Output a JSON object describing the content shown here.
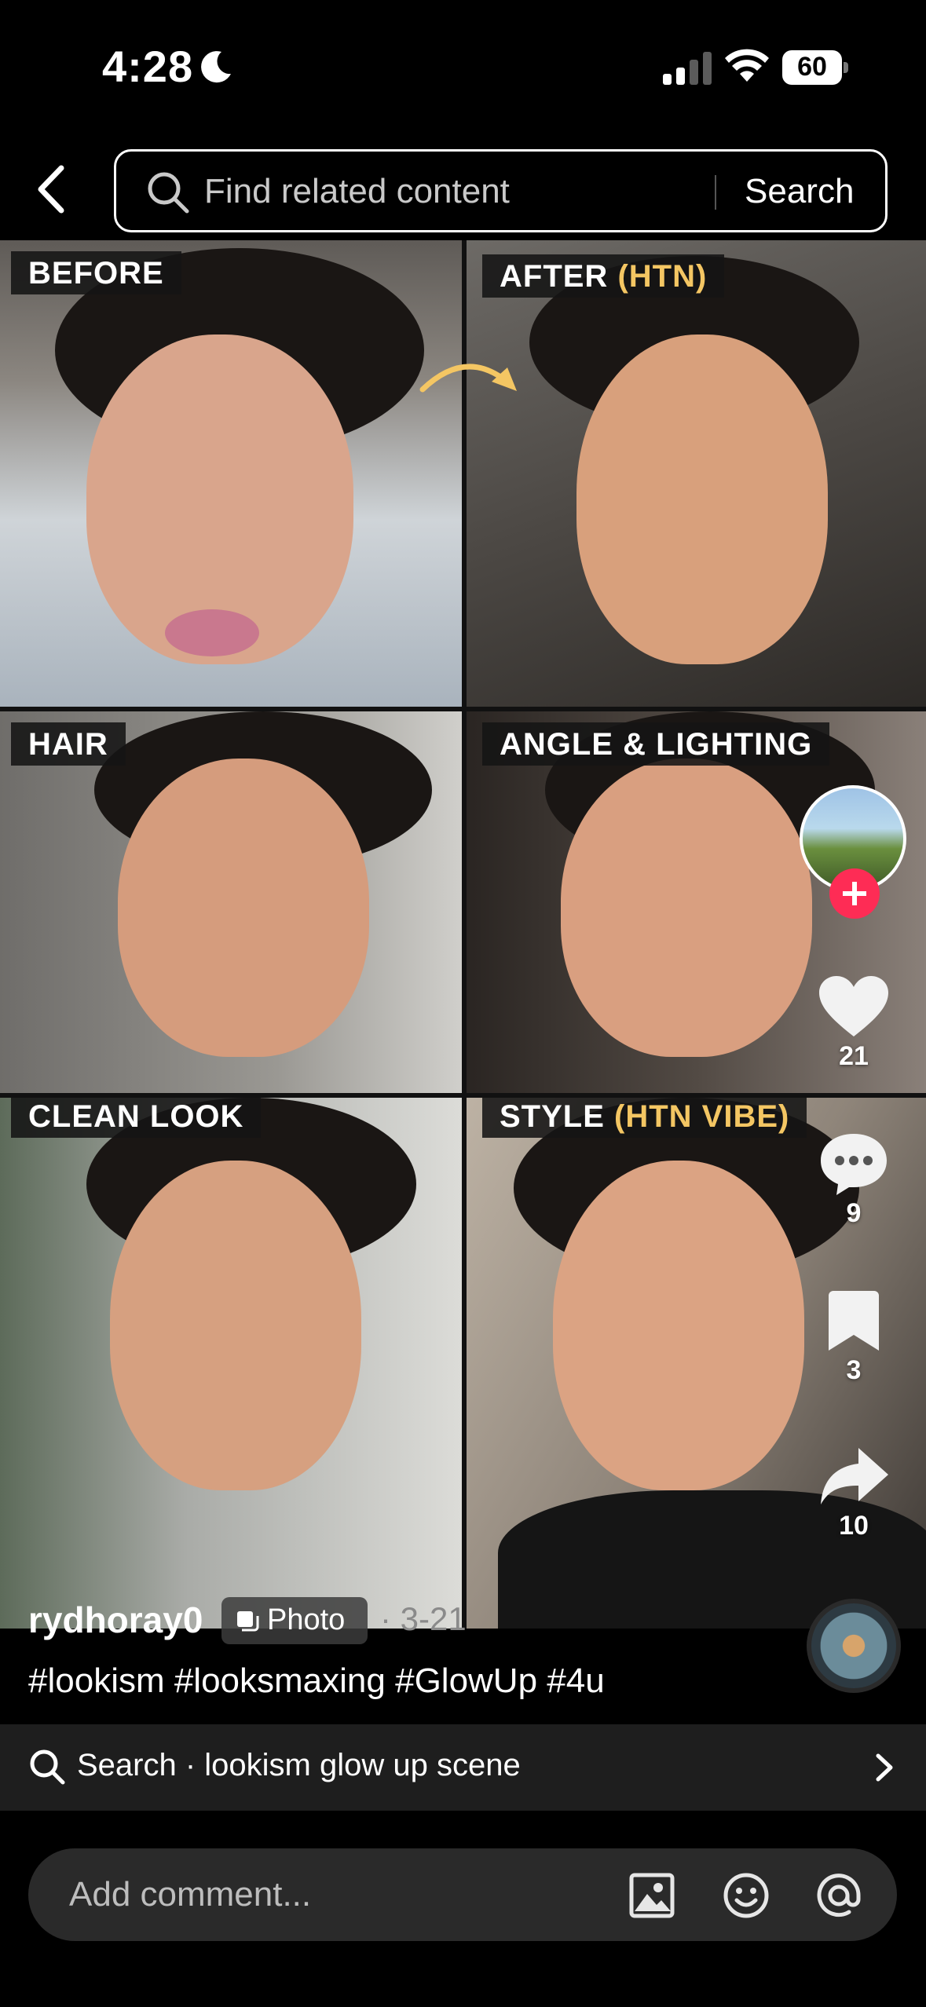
{
  "status_bar": {
    "time": "4:28",
    "battery": "60"
  },
  "header": {
    "search_placeholder": "Find related content",
    "search_button": "Search"
  },
  "collage": {
    "panels": [
      {
        "label": "BEFORE",
        "highlight": ""
      },
      {
        "label": "AFTER ",
        "highlight": "(HTN)"
      },
      {
        "label": "HAIR",
        "highlight": ""
      },
      {
        "label": "ANGLE & LIGHTING",
        "highlight": ""
      },
      {
        "label": "CLEAN LOOK",
        "highlight": ""
      },
      {
        "label": "STYLE ",
        "highlight": "(HTN VIBE)"
      }
    ]
  },
  "actions": {
    "likes": "21",
    "comments": "9",
    "saves": "3",
    "shares": "10"
  },
  "post": {
    "author": "rydhoray0",
    "type": "Photo",
    "date": "· 3-21",
    "hashtags": "#lookism #looksmaxing #GlowUp #4u"
  },
  "related_search": {
    "text": "Search · lookism glow up scene"
  },
  "comment": {
    "placeholder": "Add comment..."
  },
  "colors": {
    "accent": "#fe2c55",
    "highlight": "#f4c663",
    "background": "#000000"
  }
}
